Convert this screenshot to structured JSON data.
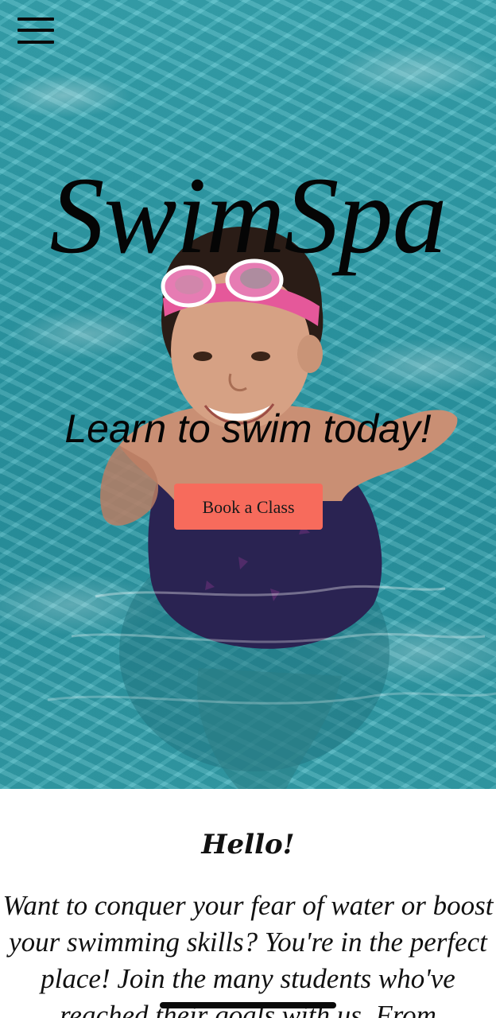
{
  "navigation": {
    "menu_icon": "hamburger-menu-icon"
  },
  "hero": {
    "brand_title": "SwimSpa",
    "tagline": "Learn to swim today!",
    "cta_label": "Book a Class",
    "image_subject": "swimmer-photo",
    "colors": {
      "water": "#34a7b3",
      "cta_background": "#f76b5c",
      "text": "#050505"
    }
  },
  "intro": {
    "heading": "Hello!",
    "body": "Want to conquer your fear of water or boost your swimming skills? You're in the perfect place! Join the many students who've reached their goals with us. From"
  }
}
